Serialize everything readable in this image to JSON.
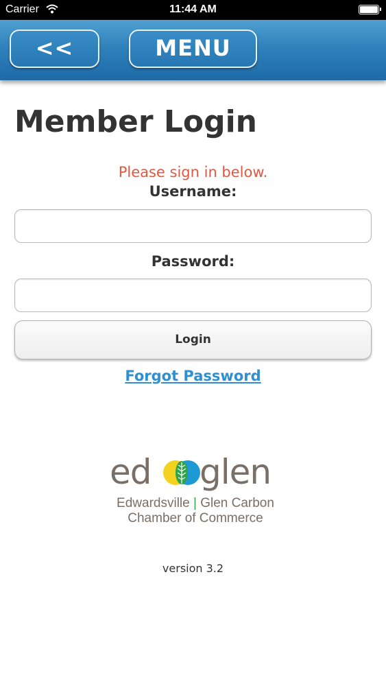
{
  "status_bar": {
    "carrier": "Carrier",
    "time": "11:44 AM"
  },
  "nav": {
    "back_label": "<<",
    "menu_label": "MENU"
  },
  "page": {
    "title": "Member Login",
    "prompt": "Please sign in below.",
    "username_label": "Username:",
    "username_value": "",
    "password_label": "Password:",
    "password_value": "",
    "login_label": "Login",
    "forgot_label": "Forgot Password"
  },
  "logo": {
    "word_left": "ed",
    "word_right": "glen",
    "tagline_left": "Edwardsville",
    "tagline_divider": "|",
    "tagline_right": "Glen Carbon",
    "tagline_line2": "Chamber of Commerce"
  },
  "footer": {
    "version": "version 3.2"
  },
  "colors": {
    "nav_blue": "#2d7fba",
    "prompt_red": "#e5573f",
    "link_blue": "#2f8fd0",
    "logo_gray": "#7a6f67",
    "logo_green": "#2fa34a",
    "logo_yellow": "#f2d21e",
    "logo_blue": "#1d9ad6"
  }
}
